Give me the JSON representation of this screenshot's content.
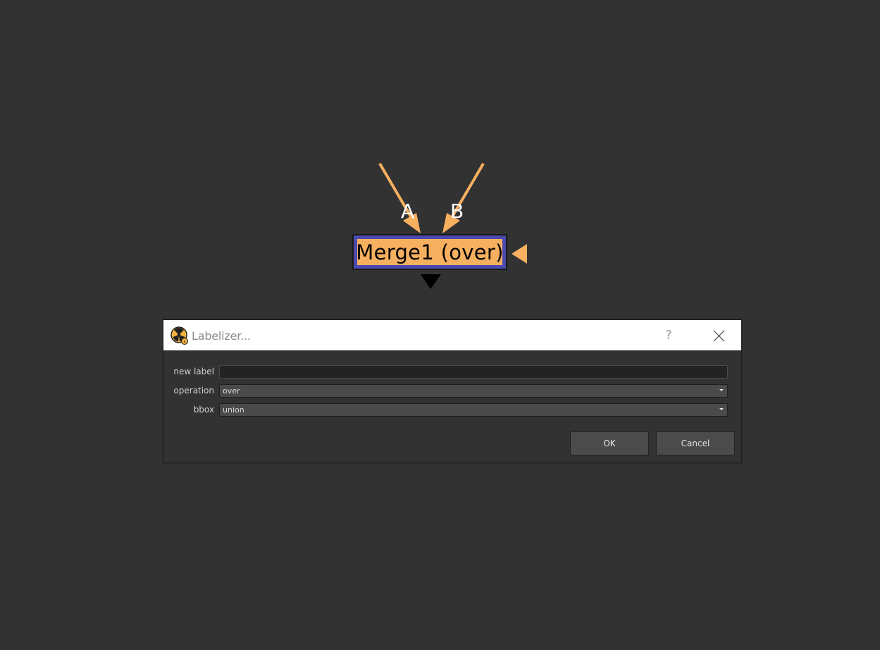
{
  "node": {
    "label": "Merge1 (over)",
    "input_a": "A",
    "input_b": "B",
    "fill_color": "#f7b060",
    "border_color": "#4a4ab0",
    "pipe_color": "#f7b060"
  },
  "dialog": {
    "title": "Labelizer...",
    "help_label": "?",
    "icons": {
      "app": "nuke-app-icon",
      "close": "close-icon"
    },
    "fields": {
      "new_label": {
        "label": "new label",
        "value": ""
      },
      "operation": {
        "label": "operation",
        "value": "over"
      },
      "bbox": {
        "label": "bbox",
        "value": "union"
      }
    },
    "buttons": {
      "ok": "OK",
      "cancel": "Cancel"
    }
  }
}
